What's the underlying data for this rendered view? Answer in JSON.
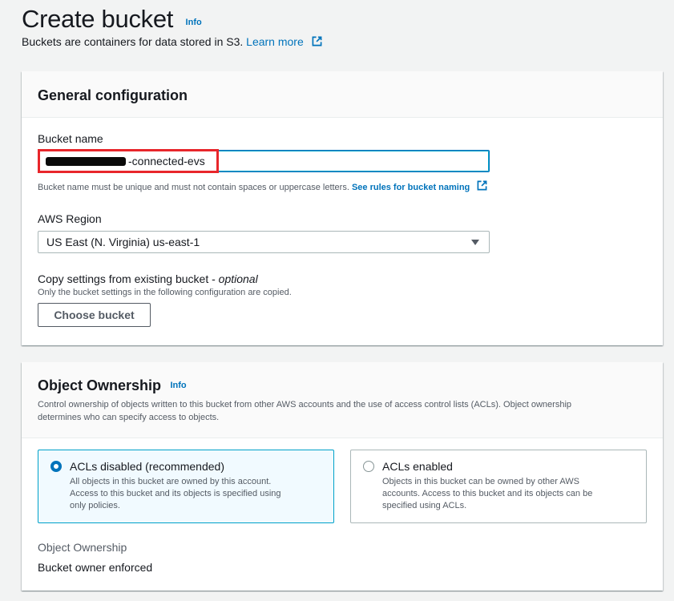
{
  "header": {
    "title": "Create bucket",
    "info": "Info",
    "subtitle": "Buckets are containers for data stored in S3.",
    "learn_more": "Learn more"
  },
  "general": {
    "title": "General configuration",
    "bucket_name_label": "Bucket name",
    "bucket_name_value": "-connected-evs",
    "bucket_name_hint": "Bucket name must be unique and must not contain spaces or uppercase letters.",
    "rules_link": "See rules for bucket naming",
    "region_label": "AWS Region",
    "region_value": "US East (N. Virginia) us-east-1",
    "copy_label": "Copy settings from existing bucket -",
    "copy_optional": "optional",
    "copy_desc": "Only the bucket settings in the following configuration are copied.",
    "choose_button": "Choose bucket"
  },
  "ownership": {
    "title": "Object Ownership",
    "info": "Info",
    "desc_line1": "Control ownership of objects written to this bucket from other AWS accounts and the use of access control lists (ACLs). Object ownership",
    "desc_line2": "determines who can specify access to objects.",
    "option_disabled": {
      "title": "ACLs disabled (recommended)",
      "line1": "All objects in this bucket are owned by this account.",
      "line2": "Access to this bucket and its objects is specified using",
      "line3": "only policies.",
      "selected": true
    },
    "option_enabled": {
      "title": "ACLs enabled",
      "line1": "Objects in this bucket can be owned by other AWS",
      "line2": "accounts. Access to this bucket and its objects can be",
      "line3": "specified using ACLs.",
      "selected": false
    },
    "result_label": "Object Ownership",
    "result_value": "Bucket owner enforced"
  },
  "colors": {
    "link": "#0073bb",
    "selected_border": "#00a1c9",
    "highlight": "#e8262b"
  }
}
